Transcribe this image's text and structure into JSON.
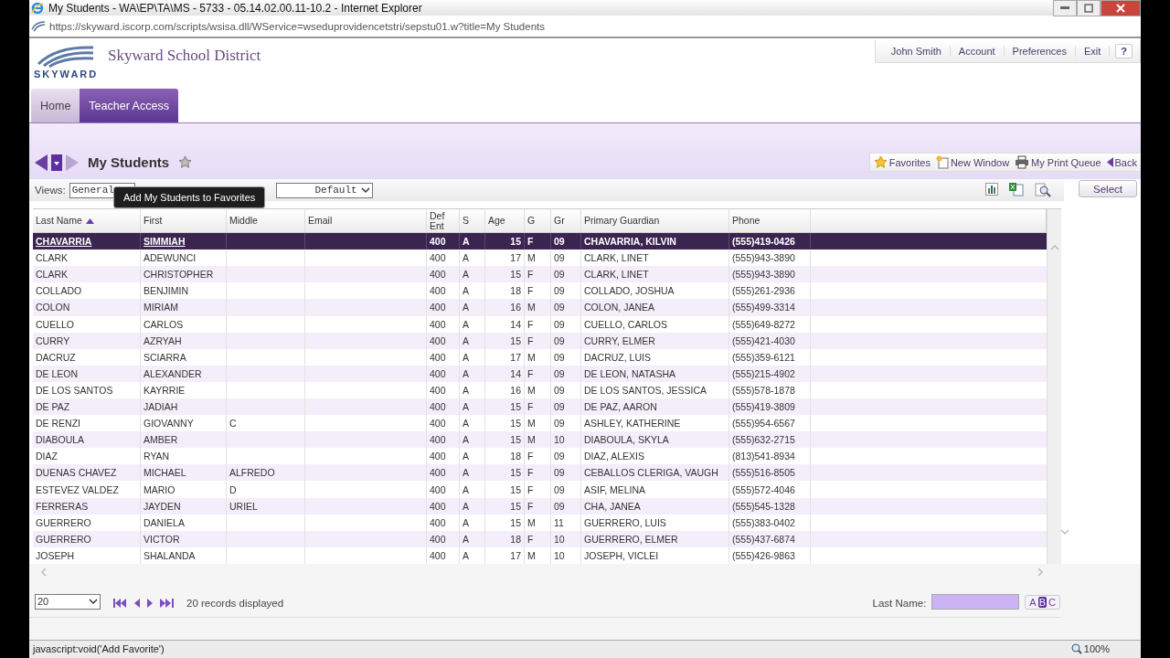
{
  "window": {
    "title": "My Students - WA\\EP\\TA\\MS - 5733 - 05.14.02.00.11-10.2 - Internet Explorer"
  },
  "address_bar": {
    "url": "https://skyward.iscorp.com/scripts/wsisa.dll/WService=wseduprovidencetstri/sepstu01.w?title=My Students"
  },
  "header": {
    "logo_text": "SKYWARD",
    "district": "Skyward School District",
    "user_menu": [
      "John Smith",
      "Account",
      "Preferences",
      "Exit",
      "?"
    ]
  },
  "tabs": [
    {
      "label": "Home",
      "selected": false
    },
    {
      "label": "Teacher Access",
      "selected": true
    }
  ],
  "page": {
    "title": "My Students",
    "tooltip": "Add My Students to Favorites"
  },
  "toolbar": [
    {
      "label": "Favorites",
      "kind": "favorites"
    },
    {
      "label": "New Window",
      "kind": "window"
    },
    {
      "label": "My Print Queue",
      "kind": "print"
    },
    {
      "label": "Back",
      "kind": "back"
    }
  ],
  "views": {
    "label": "Views:",
    "value": "General",
    "filter_value": "Default",
    "select_button": "Select"
  },
  "table": {
    "columns": [
      {
        "label": "Last Name",
        "sorted": true
      },
      {
        "label": "First",
        "sorted": false
      },
      {
        "label": "Middle",
        "sorted": false
      },
      {
        "label": "Email",
        "sorted": false
      },
      {
        "label": "Def Ent",
        "sorted": false
      },
      {
        "label": "S",
        "sorted": false
      },
      {
        "label": "Age",
        "sorted": false
      },
      {
        "label": "G",
        "sorted": false
      },
      {
        "label": "Gr",
        "sorted": false
      },
      {
        "label": "Primary Guardian",
        "sorted": false
      },
      {
        "label": "Phone",
        "sorted": false
      }
    ],
    "rows": [
      {
        "selected": true,
        "cells": [
          "CHAVARRIA",
          "SIMMIAH",
          "",
          "",
          "400",
          "A",
          "15",
          "F",
          "09",
          "CHAVARRIA, KILVIN",
          "(555)419-0426"
        ]
      },
      {
        "selected": false,
        "cells": [
          "CLARK",
          "ADEWUNCI",
          "",
          "",
          "400",
          "A",
          "17",
          "M",
          "09",
          "CLARK, LINET",
          "(555)943-3890"
        ]
      },
      {
        "selected": false,
        "cells": [
          "CLARK",
          "CHRISTOPHER",
          "",
          "",
          "400",
          "A",
          "15",
          "F",
          "09",
          "CLARK, LINET",
          "(555)943-3890"
        ]
      },
      {
        "selected": false,
        "cells": [
          "COLLADO",
          "BENJIMIN",
          "",
          "",
          "400",
          "A",
          "18",
          "F",
          "09",
          "COLLADO, JOSHUA",
          "(555)261-2936"
        ]
      },
      {
        "selected": false,
        "cells": [
          "COLON",
          "MIRIAM",
          "",
          "",
          "400",
          "A",
          "16",
          "M",
          "09",
          "COLON, JANEA",
          "(555)499-3314"
        ]
      },
      {
        "selected": false,
        "cells": [
          "CUELLO",
          "CARLOS",
          "",
          "",
          "400",
          "A",
          "14",
          "F",
          "09",
          "CUELLO, CARLOS",
          "(555)649-8272"
        ]
      },
      {
        "selected": false,
        "cells": [
          "CURRY",
          "AZRYAH",
          "",
          "",
          "400",
          "A",
          "15",
          "F",
          "09",
          "CURRY, ELMER",
          "(555)421-4030"
        ]
      },
      {
        "selected": false,
        "cells": [
          "DACRUZ",
          "SCIARRA",
          "",
          "",
          "400",
          "A",
          "17",
          "M",
          "09",
          "DACRUZ, LUIS",
          "(555)359-6121"
        ]
      },
      {
        "selected": false,
        "cells": [
          "DE LEON",
          "ALEXANDER",
          "",
          "",
          "400",
          "A",
          "14",
          "F",
          "09",
          "DE LEON, NATASHA",
          "(555)215-4902"
        ]
      },
      {
        "selected": false,
        "cells": [
          "DE LOS SANTOS",
          "KAYRRIE",
          "",
          "",
          "400",
          "A",
          "16",
          "M",
          "09",
          "DE LOS SANTOS, JESSICA",
          "(555)578-1878"
        ]
      },
      {
        "selected": false,
        "cells": [
          "DE PAZ",
          "JADIAH",
          "",
          "",
          "400",
          "A",
          "15",
          "F",
          "09",
          "DE PAZ, AARON",
          "(555)419-3809"
        ]
      },
      {
        "selected": false,
        "cells": [
          "DE RENZI",
          "GIOVANNY",
          "C",
          "",
          "400",
          "A",
          "15",
          "M",
          "09",
          "ASHLEY, KATHERINE",
          "(555)954-6567"
        ]
      },
      {
        "selected": false,
        "cells": [
          "DIABOULA",
          "AMBER",
          "",
          "",
          "400",
          "A",
          "15",
          "M",
          "10",
          "DIABOULA, SKYLA",
          "(555)632-2715"
        ]
      },
      {
        "selected": false,
        "cells": [
          "DIAZ",
          "RYAN",
          "",
          "",
          "400",
          "A",
          "18",
          "F",
          "09",
          "DIAZ, ALEXIS",
          "(813)541-8934"
        ]
      },
      {
        "selected": false,
        "cells": [
          "DUENAS CHAVEZ",
          "MICHAEL",
          "ALFREDO",
          "",
          "400",
          "A",
          "15",
          "F",
          "09",
          "CEBALLOS CLERIGA, VAUGH",
          "(555)516-8505"
        ]
      },
      {
        "selected": false,
        "cells": [
          "ESTEVEZ VALDEZ",
          "MARIO",
          "D",
          "",
          "400",
          "A",
          "15",
          "F",
          "09",
          "ASIF, MELINA",
          "(555)572-4046"
        ]
      },
      {
        "selected": false,
        "cells": [
          "FERRERAS",
          "JAYDEN",
          "URIEL",
          "",
          "400",
          "A",
          "15",
          "F",
          "09",
          "CHA, JANEA",
          "(555)545-1328"
        ]
      },
      {
        "selected": false,
        "cells": [
          "GUERRERO",
          "DANIELA",
          "",
          "",
          "400",
          "A",
          "15",
          "M",
          "11",
          "GUERRERO, LUIS",
          "(555)383-0402"
        ]
      },
      {
        "selected": false,
        "cells": [
          "GUERRERO",
          "VICTOR",
          "",
          "",
          "400",
          "A",
          "18",
          "F",
          "10",
          "GUERRERO, ELMER",
          "(555)437-6874"
        ]
      },
      {
        "selected": false,
        "cells": [
          "JOSEPH",
          "SHALANDA",
          "",
          "",
          "400",
          "A",
          "17",
          "M",
          "10",
          "JOSEPH, VICLEI",
          "(555)426-9863"
        ]
      }
    ]
  },
  "footer": {
    "page_size": "20",
    "records": "20 records displayed",
    "search_label": "Last Name:",
    "search_modes": [
      {
        "label": "A",
        "selected": false
      },
      {
        "label": "B",
        "selected": true
      },
      {
        "label": "C",
        "selected": false
      }
    ]
  },
  "status_bar": {
    "text": "javascript:void('Add Favorite')",
    "zoom": "100%"
  }
}
